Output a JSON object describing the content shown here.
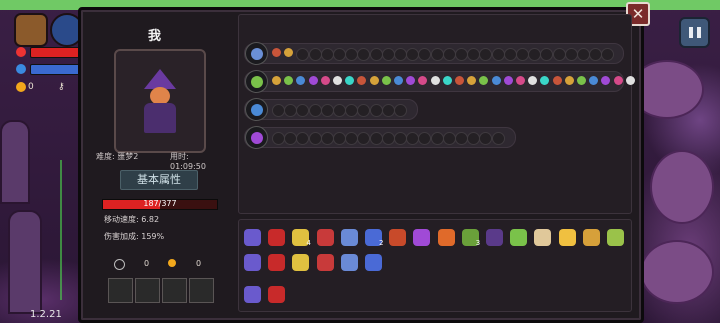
{
  "version": "1.2.21",
  "hud": {
    "gem_count": "0",
    "key_count": "0"
  },
  "character": {
    "name": "我",
    "difficulty_label": "难度: 噩梦2",
    "time_label": "用时: 01:09:50",
    "attributes_tab": "基本属性",
    "hp_current": 187,
    "hp_max": 377,
    "hp_text": "187/377",
    "move_speed_label": "移动速度: 6.82",
    "damage_bonus_label": "伤害加成: 159%",
    "key_count": "0",
    "coin_count": "0"
  },
  "colors": {
    "accent": "#d22222",
    "panel": "#1f1a1f",
    "coin": "#f2a81c"
  },
  "weapon_rows": [
    {
      "icon": "chest-weapon-icon",
      "filled": 2,
      "empty": 26,
      "color": "#6a8fd6"
    },
    {
      "icon": "staff-weapon-icon",
      "filled": 30,
      "empty": 0,
      "color": "#7ac24a"
    },
    {
      "icon": "blue-orb-icon",
      "filled": 0,
      "empty": 11,
      "color": "#4a8ad6"
    },
    {
      "icon": "purple-wand-icon",
      "filled": 0,
      "empty": 19,
      "color": "#a04ad6"
    }
  ],
  "items_row1": [
    {
      "icon": "mage-hood-icon",
      "count": ""
    },
    {
      "icon": "red-rune-icon",
      "count": ""
    },
    {
      "icon": "teeth-necklace-icon",
      "count": "4"
    },
    {
      "icon": "demon-mask-icon",
      "count": ""
    },
    {
      "icon": "blue-crystal-icon",
      "count": ""
    },
    {
      "icon": "scroll-icon",
      "count": "2"
    },
    {
      "icon": "dna-icon",
      "count": ""
    },
    {
      "icon": "witch-hat-icon",
      "count": ""
    },
    {
      "icon": "heart-icon",
      "count": ""
    },
    {
      "icon": "snake-icon",
      "count": "3"
    },
    {
      "icon": "cloak-icon",
      "count": ""
    },
    {
      "icon": "green-gem-icon",
      "count": ""
    },
    {
      "icon": "fang-icon",
      "count": ""
    },
    {
      "icon": "cheese-icon",
      "count": ""
    },
    {
      "icon": "skull-icon",
      "count": ""
    },
    {
      "icon": "leaf-icon",
      "count": ""
    }
  ],
  "items_row2": [
    {
      "icon": "herb-icon",
      "count": ""
    },
    {
      "icon": "feather-icon",
      "count": ""
    },
    {
      "icon": "grimoire-icon",
      "count": ""
    },
    {
      "icon": "potion-icon",
      "count": ""
    },
    {
      "icon": "map-icon",
      "count": ""
    },
    {
      "icon": "compass-icon",
      "count": ""
    }
  ],
  "items_row3": [
    {
      "icon": "swirl-icon",
      "count": ""
    },
    {
      "icon": "swirl-icon",
      "count": ""
    }
  ]
}
